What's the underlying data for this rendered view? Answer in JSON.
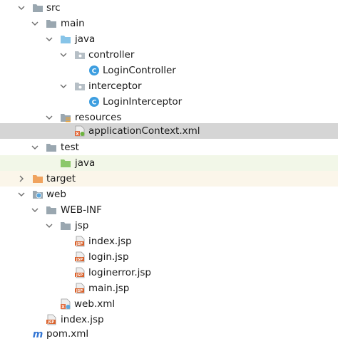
{
  "tree": {
    "items": [
      {
        "label": "src",
        "name": "tree-item-src"
      },
      {
        "label": "main",
        "name": "tree-item-main"
      },
      {
        "label": "java",
        "name": "tree-item-main-java"
      },
      {
        "label": "controller",
        "name": "tree-item-controller"
      },
      {
        "label": "LoginController",
        "name": "tree-item-login-controller"
      },
      {
        "label": "interceptor",
        "name": "tree-item-interceptor"
      },
      {
        "label": "LoginInterceptor",
        "name": "tree-item-login-interceptor"
      },
      {
        "label": "resources",
        "name": "tree-item-resources"
      },
      {
        "label": "applicationContext.xml",
        "name": "tree-item-application-context"
      },
      {
        "label": "test",
        "name": "tree-item-test"
      },
      {
        "label": "java",
        "name": "tree-item-test-java"
      },
      {
        "label": "target",
        "name": "tree-item-target"
      },
      {
        "label": "web",
        "name": "tree-item-web"
      },
      {
        "label": "WEB-INF",
        "name": "tree-item-web-inf"
      },
      {
        "label": "jsp",
        "name": "tree-item-jsp"
      },
      {
        "label": "index.jsp",
        "name": "tree-item-index-jsp"
      },
      {
        "label": "login.jsp",
        "name": "tree-item-login-jsp"
      },
      {
        "label": "loginerror.jsp",
        "name": "tree-item-loginerror-jsp"
      },
      {
        "label": "main.jsp",
        "name": "tree-item-main-jsp"
      },
      {
        "label": "web.xml",
        "name": "tree-item-web-xml"
      },
      {
        "label": "index.jsp",
        "name": "tree-item-web-index-jsp"
      },
      {
        "label": "pom.xml",
        "name": "tree-item-pom-xml"
      }
    ]
  },
  "colors": {
    "selected_row": "#d5d5d5",
    "test_row": "#f2f7e8",
    "excluded_row": "#fbf6ea",
    "folder_gray": "#9aa7b0",
    "folder_blue": "#87c4e8",
    "folder_green": "#8cc86b",
    "folder_orange": "#f0a35e",
    "class_icon": "#3d9ee0",
    "maven_blue": "#3577d4"
  },
  "icons": {
    "expanded": "chevron-down-icon",
    "collapsed": "chevron-right-icon",
    "folder": "folder-icon",
    "source_root": "source-folder-icon",
    "package": "package-icon",
    "java_class": "java-class-icon",
    "resources_root": "resources-folder-icon",
    "xml_file": "spring-xml-icon",
    "test_root": "test-folder-icon",
    "excluded": "excluded-folder-icon",
    "web_root": "web-folder-icon",
    "jsp_file": "jsp-file-icon",
    "maven_file": "maven-icon"
  }
}
